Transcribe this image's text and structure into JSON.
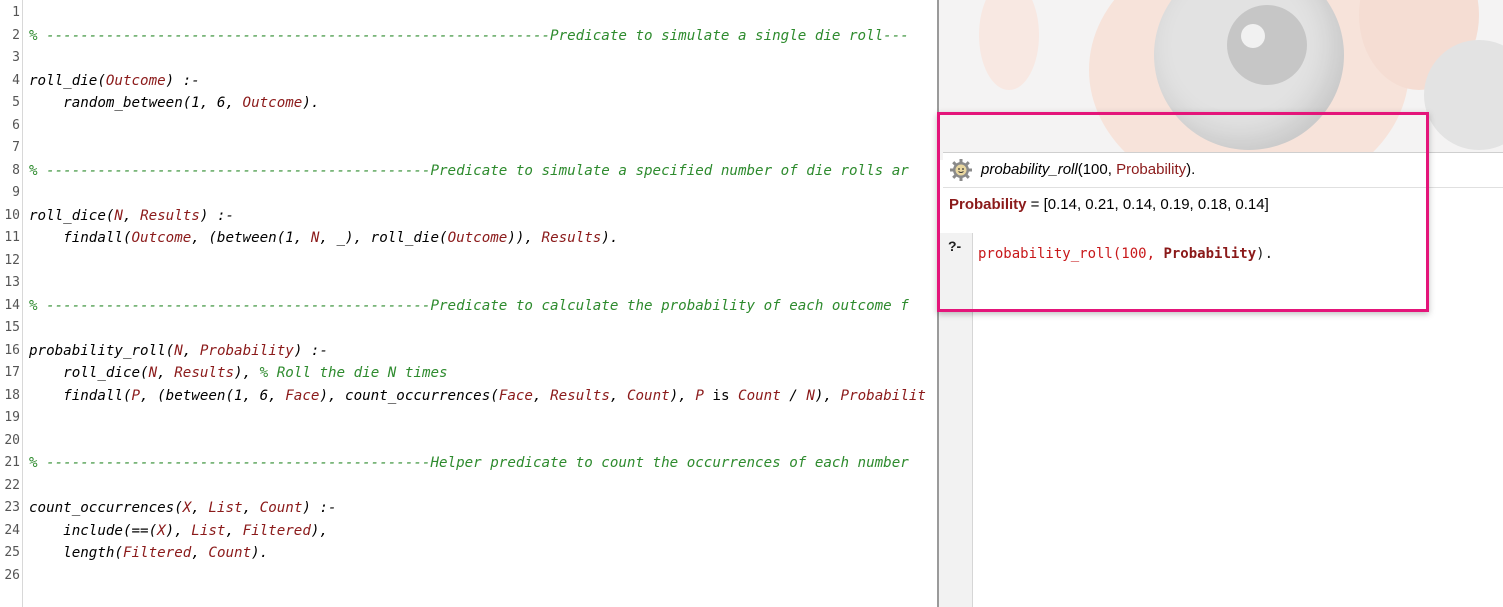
{
  "editor": {
    "line_numbers": [
      "1",
      "2",
      "3",
      "4",
      "5",
      "6",
      "7",
      "8",
      "9",
      "10",
      "11",
      "12",
      "13",
      "14",
      "15",
      "16",
      "17",
      "18",
      "19",
      "20",
      "21",
      "22",
      "23",
      "24",
      "25",
      "26"
    ],
    "lines": {
      "l2": "% -----------------------------------------------------------Predicate to simulate a single die roll---",
      "l4a": "roll_die(",
      "l4b": "Outcome",
      "l4c": ") :-",
      "l5a": "    random_between(1, 6, ",
      "l5b": "Outcome",
      "l5c": ").",
      "l8": "% ---------------------------------------------Predicate to simulate a specified number of die rolls ar",
      "l10a": "roll_dice(",
      "l10b": "N",
      "l10c": ", ",
      "l10d": "Results",
      "l10e": ") :-",
      "l11a": "    findall(",
      "l11b": "Outcome",
      "l11c": ", (between(1, ",
      "l11d": "N",
      "l11e": ", _), roll_die(",
      "l11f": "Outcome",
      "l11g": ")), ",
      "l11h": "Results",
      "l11i": ").",
      "l14": "% ---------------------------------------------Predicate to calculate the probability of each outcome f",
      "l16a": "probability_roll(",
      "l16b": "N",
      "l16c": ", ",
      "l16d": "Probability",
      "l16e": ") :-",
      "l17a": "    roll_dice(",
      "l17b": "N",
      "l17c": ", ",
      "l17d": "Results",
      "l17e": "), ",
      "l17f": "% Roll the die N times",
      "l18a": "    findall(",
      "l18b": "P",
      "l18c": ", (between(1, 6, ",
      "l18d": "Face",
      "l18e": "), count_occurrences(",
      "l18f": "Face",
      "l18g": ", ",
      "l18h": "Results",
      "l18i": ", ",
      "l18j": "Count",
      "l18k": "), ",
      "l18l": "P",
      "l18m": " is ",
      "l18n": "Count",
      "l18o": " / ",
      "l18p": "N",
      "l18q": "), ",
      "l18r": "Probabilit",
      "l21": "% ---------------------------------------------Helper predicate to count the occurrences of each number",
      "l23a": "count_occurrences(",
      "l23b": "X",
      "l23c": ", ",
      "l23d": "List",
      "l23e": ", ",
      "l23f": "Count",
      "l23g": ") :-",
      "l24a": "    include(==(",
      "l24b": "X",
      "l24c": "), ",
      "l24d": "List",
      "l24e": ", ",
      "l24f": "Filtered",
      "l24g": "),",
      "l25a": "    length(",
      "l25b": "Filtered",
      "l25c": ", ",
      "l25d": "Count",
      "l25e": ")."
    }
  },
  "answer": {
    "query_name": "probability_roll",
    "query_open": "(100, ",
    "query_var": "Probability",
    "query_close": ").",
    "result_name": "Probability",
    "result_value": " = [0.14, 0.21, 0.14, 0.19, 0.18, 0.14]",
    "icon": "gear-icon"
  },
  "input": {
    "prompt": "?-",
    "text_a": "probability_roll(100, ",
    "text_b": "Probability",
    "text_c": ")."
  },
  "colors": {
    "highlight": "#e4157a",
    "variable": "#8b1a1a",
    "comment": "#2e8b2e"
  }
}
